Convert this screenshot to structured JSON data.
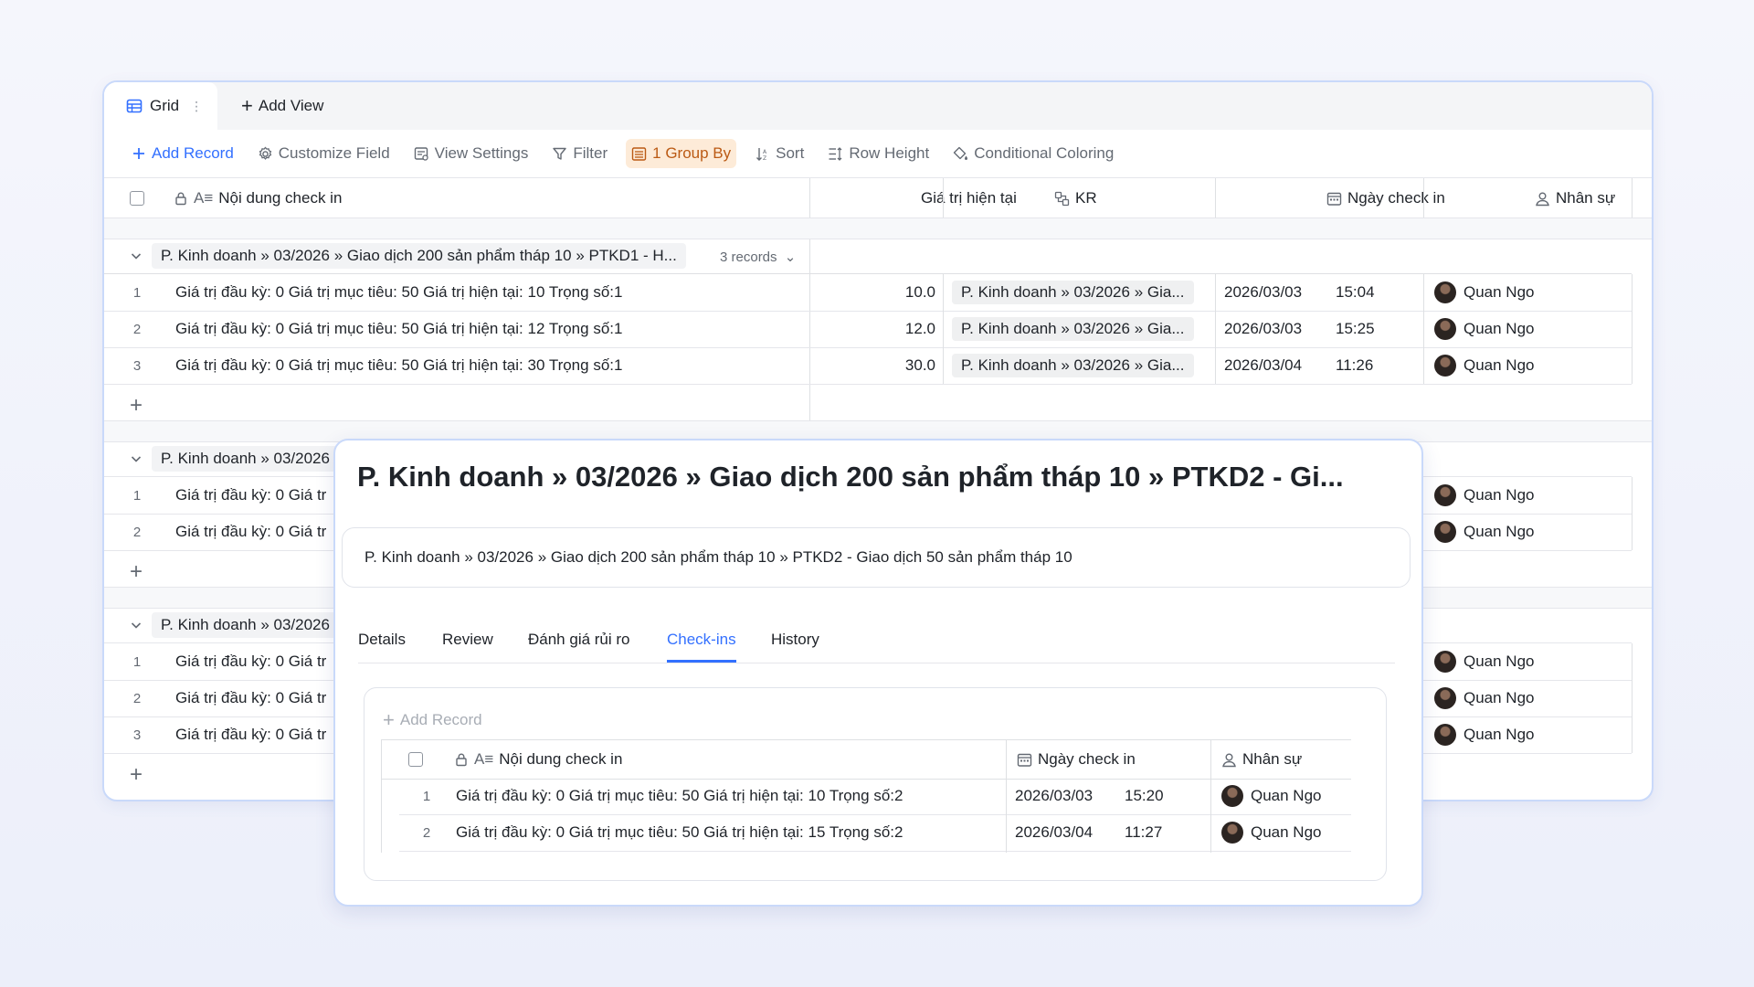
{
  "views": {
    "grid_tab_label": "Grid",
    "add_view_label": "Add View"
  },
  "toolbar": {
    "add_record": "Add Record",
    "customize_field": "Customize Field",
    "view_settings": "View Settings",
    "filter": "Filter",
    "group_by": "1 Group By",
    "sort": "Sort",
    "row_height": "Row Height",
    "conditional_coloring": "Conditional Coloring"
  },
  "columns": {
    "content": "Nội dung check in",
    "current_value": "Giá trị hiện tại",
    "kr": "KR",
    "date": "Ngày check in",
    "person": "Nhân sự"
  },
  "groups": [
    {
      "path": "P. Kinh doanh » 03/2026 » Giao dịch 200 sản phẩm tháp 10 » PTKD1 - H...",
      "count": "3 records",
      "rows": [
        {
          "num": "1",
          "content": "Giá trị đầu kỳ: 0 Giá trị mục tiêu: 50 Giá trị hiện tại: 10 Trọng số:1",
          "value": "10.0",
          "kr": "P. Kinh doanh » 03/2026 » Gia...",
          "date": "2026/03/03",
          "time": "15:04",
          "person": "Quan Ngo"
        },
        {
          "num": "2",
          "content": "Giá trị đầu kỳ: 0 Giá trị mục tiêu: 50 Giá trị hiện tại: 12 Trọng số:1",
          "value": "12.0",
          "kr": "P. Kinh doanh » 03/2026 » Gia...",
          "date": "2026/03/03",
          "time": "15:25",
          "person": "Quan Ngo"
        },
        {
          "num": "3",
          "content": "Giá trị đầu kỳ: 0 Giá trị mục tiêu: 50 Giá trị hiện tại: 30 Trọng số:1",
          "value": "30.0",
          "kr": "P. Kinh doanh » 03/2026 » Gia...",
          "date": "2026/03/04",
          "time": "11:26",
          "person": "Quan Ngo"
        }
      ]
    },
    {
      "path": "P. Kinh doanh » 03/2026",
      "rows": [
        {
          "num": "1",
          "content": "Giá trị đầu kỳ: 0 Giá tr",
          "person": "Quan Ngo"
        },
        {
          "num": "2",
          "content": "Giá trị đầu kỳ: 0 Giá tr",
          "person": "Quan Ngo"
        }
      ]
    },
    {
      "path": "P. Kinh doanh » 03/2026",
      "rows": [
        {
          "num": "1",
          "content": "Giá trị đầu kỳ: 0 Giá tr",
          "person": "Quan Ngo"
        },
        {
          "num": "2",
          "content": "Giá trị đầu kỳ: 0 Giá tr",
          "person": "Quan Ngo"
        },
        {
          "num": "3",
          "content": "Giá trị đầu kỳ: 0 Giá tr",
          "person": "Quan Ngo"
        }
      ]
    }
  ],
  "modal": {
    "title": "P. Kinh doanh » 03/2026 » Giao dịch 200 sản phẩm tháp 10 » PTKD2 - Gi...",
    "full_name": "P. Kinh doanh » 03/2026 » Giao dịch 200 sản phẩm tháp 10 » PTKD2 - Giao dịch 50 sản phẩm tháp 10",
    "tabs": [
      "Details",
      "Review",
      "Đánh giá rủi ro",
      "Check-ins",
      "History"
    ],
    "active_tab": "Check-ins",
    "add_record": "Add Record",
    "columns": {
      "content": "Nội dung check in",
      "date": "Ngày check in",
      "person": "Nhân sự"
    },
    "rows": [
      {
        "num": "1",
        "content": "Giá trị đầu kỳ: 0 Giá trị mục tiêu: 50 Giá trị hiện tại: 10 Trọng số:2",
        "date": "2026/03/03",
        "time": "15:20",
        "person": "Quan Ngo"
      },
      {
        "num": "2",
        "content": "Giá trị đầu kỳ: 0 Giá trị mục tiêu: 50 Giá trị hiện tại: 15 Trọng số:2",
        "date": "2026/03/04",
        "time": "11:27",
        "person": "Quan Ngo"
      }
    ]
  },
  "colors": {
    "accent": "#3370ff",
    "group_by_bg": "#fdebd8",
    "group_by_text": "#bb5a14",
    "border_highlight": "#c9d9fa"
  }
}
